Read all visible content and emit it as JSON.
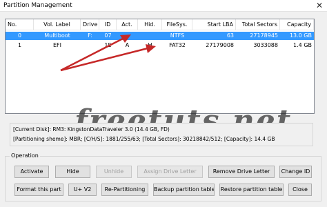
{
  "window": {
    "title": "Partition Management",
    "close_glyph": "✕"
  },
  "table": {
    "columns": [
      "No.",
      "Vol. Label",
      "Drive",
      "ID",
      "Act.",
      "Hid.",
      "FileSys.",
      "Start LBA",
      "Total Sectors",
      "Capacity"
    ],
    "rows": [
      {
        "no": "0",
        "label": "Multiboot",
        "drive": "F:",
        "id": "07",
        "act": "",
        "hid": "",
        "fs": "NTFS",
        "start": "63",
        "total": "27178945",
        "capacity": "13.0 GB",
        "selected": true
      },
      {
        "no": "1",
        "label": "EFI",
        "drive": "",
        "id": "1E",
        "act": "A",
        "hid": "H",
        "fs": "FAT32",
        "start": "27179008",
        "total": "3033088",
        "capacity": "1.4 GB",
        "selected": false
      }
    ]
  },
  "info": {
    "line1": "[Current Disk]: RM3: KingstonDataTraveler 3.0 (14.4 GB, FD)",
    "line2": "[Partitioning sheme]:     MBR;     [C/H/S]: 1881/255/63; [Total Sectors]: 30218842/512; [Capacity]: 14.4 GB"
  },
  "watermark": "freetuts.net",
  "operation": {
    "label": "Operation",
    "row1": [
      "Activate",
      "Hide",
      "Unhide",
      "Assign Drive Letter",
      "Remove Drive Letter",
      "Change ID"
    ],
    "row2": [
      "Format this part",
      "U+ V2",
      "Re-Partitioning",
      "Backup partition table",
      "Restore partition table",
      "Close"
    ]
  },
  "colors": {
    "selection": "#3399ff",
    "arrow": "#c62828"
  }
}
